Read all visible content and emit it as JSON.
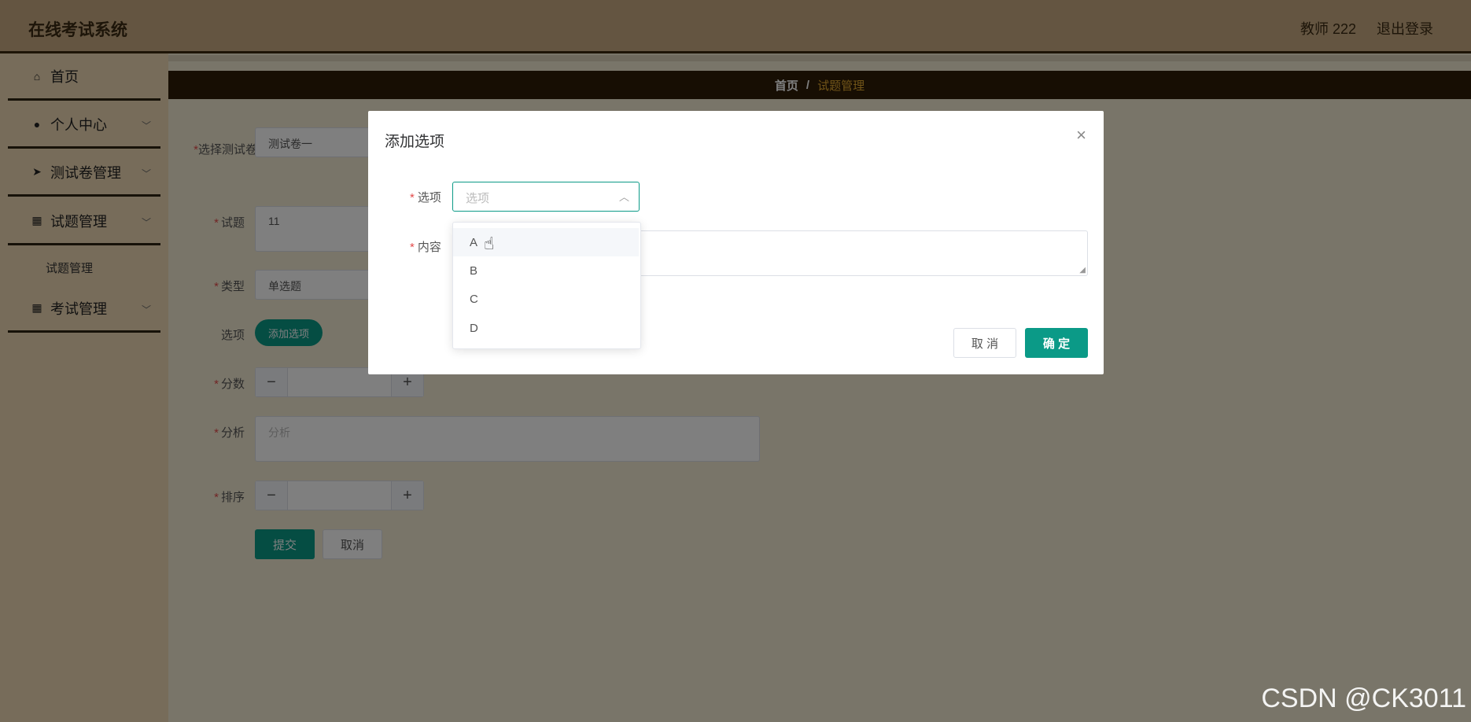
{
  "header": {
    "title": "在线考试系统",
    "user": "教师 222",
    "logout": "退出登录"
  },
  "sidebar": {
    "items": [
      {
        "label": "首页",
        "icon": "home-icon"
      },
      {
        "label": "个人中心",
        "icon": "user-icon"
      },
      {
        "label": "测试卷管理",
        "icon": "send-icon"
      },
      {
        "label": "试题管理",
        "icon": "grid-icon"
      },
      {
        "label": "考试管理",
        "icon": "grid-icon"
      }
    ],
    "sub_item": "试题管理"
  },
  "breadcrumb": {
    "home": "首页",
    "separator": "/",
    "current": "试题管理"
  },
  "form": {
    "paper_label": "选择测试卷",
    "paper_value": "测试卷一",
    "question_label": "试题",
    "question_value": "11",
    "type_label": "类型",
    "type_value": "单选题",
    "options_label": "选项",
    "add_option_button": "添加选项",
    "score_label": "分数",
    "analysis_label": "分析",
    "analysis_placeholder": "分析",
    "order_label": "排序",
    "submit_button": "提交",
    "cancel_button": "取消",
    "stepper_minus": "−",
    "stepper_plus": "+"
  },
  "dialog": {
    "title": "添加选项",
    "close_icon": "×",
    "option_label": "选项",
    "option_placeholder": "选项",
    "content_label": "内容",
    "cancel_button": "取 消",
    "confirm_button": "确 定",
    "dropdown_options": [
      "A",
      "B",
      "C",
      "D"
    ]
  },
  "watermark": "CSDN @CK3011",
  "colors": {
    "accent": "#0b9a87",
    "header_bg": "#c8ab83",
    "breadcrumb_bg": "#2e1d07",
    "breadcrumb_current": "#e2a930"
  }
}
